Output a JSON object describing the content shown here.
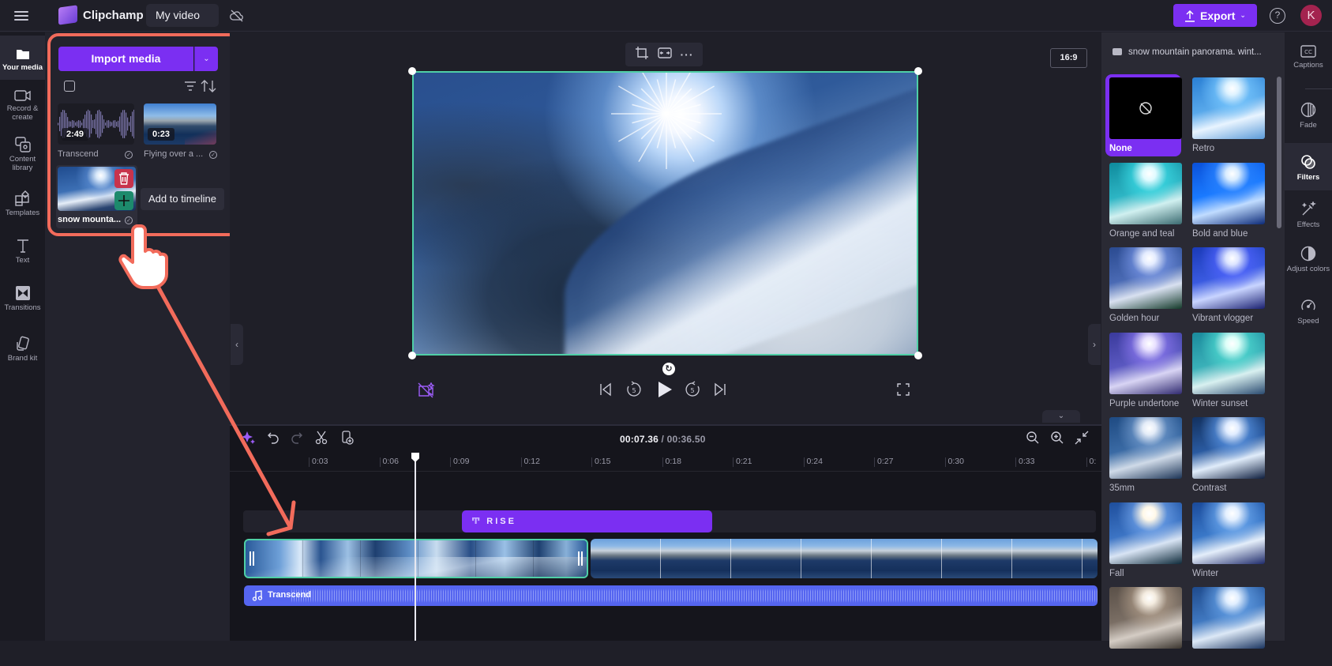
{
  "app": {
    "brand": "Clipchamp",
    "project_title": "My video",
    "export_label": "Export",
    "help_icon": "?",
    "avatar_initial": "K",
    "accent_color": "#7b2ff2",
    "annotation_color": "#f26b5b"
  },
  "left_nav": [
    {
      "label": "Your media",
      "icon": "folder-icon",
      "active": true
    },
    {
      "label": "Record & create",
      "icon": "camera-icon"
    },
    {
      "label": "Content library",
      "icon": "content-library-icon"
    },
    {
      "label": "Templates",
      "icon": "templates-icon"
    },
    {
      "label": "Text",
      "icon": "text-icon"
    },
    {
      "label": "Transitions",
      "icon": "transitions-icon"
    },
    {
      "label": "Brand kit",
      "icon": "brand-kit-icon"
    }
  ],
  "media_panel": {
    "import_label": "Import media",
    "dropdown_icon": "⌄",
    "items": [
      {
        "label": "Transcend",
        "duration": "2:49",
        "type": "audio"
      },
      {
        "label": "Flying over a ...",
        "duration": "0:23",
        "type": "video"
      },
      {
        "label": "snow mounta...",
        "type": "video",
        "hovered": true
      }
    ],
    "add_to_timeline_tooltip": "Add to timeline"
  },
  "preview": {
    "aspect_ratio": "16:9",
    "toolbar": [
      "crop-icon",
      "fit-icon",
      "more-icon"
    ]
  },
  "timeline": {
    "current_time": "00:07.36",
    "total_time": "00:36.50",
    "separator": " / ",
    "ruler_ticks": [
      "0:03",
      "0:06",
      "0:09",
      "0:12",
      "0:15",
      "0:18",
      "0:21",
      "0:24",
      "0:27",
      "0:30",
      "0:33",
      "0:"
    ],
    "text_clip_label": "RISE",
    "audio_clip_label": "Transcend"
  },
  "filter_panel": {
    "title": "snow mountain panorama. wint...",
    "filters": [
      {
        "name": "None",
        "selected": true
      },
      {
        "name": "Retro"
      },
      {
        "name": "Orange and teal"
      },
      {
        "name": "Bold and blue"
      },
      {
        "name": "Golden hour"
      },
      {
        "name": "Vibrant vlogger"
      },
      {
        "name": "Purple undertone"
      },
      {
        "name": "Winter sunset"
      },
      {
        "name": "35mm"
      },
      {
        "name": "Contrast"
      },
      {
        "name": "Fall"
      },
      {
        "name": "Winter"
      },
      {
        "name": ""
      },
      {
        "name": ""
      }
    ]
  },
  "right_nav": [
    {
      "label": "Captions",
      "icon": "captions-icon"
    },
    {
      "label": "Fade",
      "icon": "fade-icon"
    },
    {
      "label": "Filters",
      "icon": "filters-icon",
      "active": true
    },
    {
      "label": "Effects",
      "icon": "effects-icon"
    },
    {
      "label": "Adjust colors",
      "icon": "adjust-colors-icon"
    },
    {
      "label": "Speed",
      "icon": "speed-icon"
    }
  ]
}
